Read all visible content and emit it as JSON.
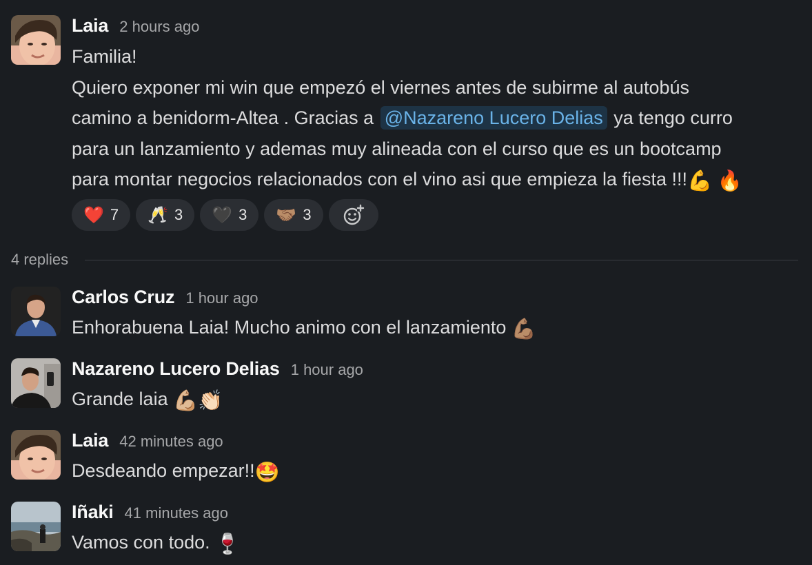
{
  "parent": {
    "author": "Laia",
    "time": "2 hours ago",
    "line1": "Familia!",
    "line2": "Quiero exponer mi win que empezó el viernes antes de subirme al autobús",
    "line3_pre": "camino a benidorm-Altea . Gracias a ",
    "mention": "@Nazareno Lucero Delias",
    "line3_post": " ya tengo curro",
    "line4": "para un lanzamiento y ademas muy alineada con el curso que es un bootcamp",
    "line5": "para montar negocios relacionados con el vino asi que empieza la fiesta !!!",
    "line5_emoji_1": "💪",
    "line5_emoji_2": "🔥",
    "reactions": [
      {
        "emoji": "❤️",
        "count": "7"
      },
      {
        "emoji": "🥂",
        "count": "3"
      },
      {
        "emoji": "🖤",
        "count": "3"
      },
      {
        "emoji": "🤝🏽",
        "count": "3"
      }
    ],
    "add_reaction_icon": "add-reaction-icon"
  },
  "thread": {
    "replies_label": "4 replies"
  },
  "replies": [
    {
      "author": "Carlos Cruz",
      "time": "1 hour ago",
      "text": "Enhorabuena Laia! Mucho animo con el lanzamiento ",
      "emoji": "💪🏽"
    },
    {
      "author": "Nazareno Lucero Delias",
      "time": "1 hour ago",
      "text": "Grande laia ",
      "emoji": "💪🏼👏🏻"
    },
    {
      "author": "Laia",
      "time": "42 minutes ago",
      "text": "Desdeando empezar!!",
      "emoji": "🤩"
    },
    {
      "author": "Iñaki",
      "time": "41 minutes ago",
      "text": "Vamos con todo. ",
      "emoji": "🍷"
    }
  ],
  "colors": {
    "background": "#1a1d21",
    "mention_bg": "#1d3345",
    "mention_text": "#6ab3e8",
    "pill_bg": "#2b2e33"
  }
}
